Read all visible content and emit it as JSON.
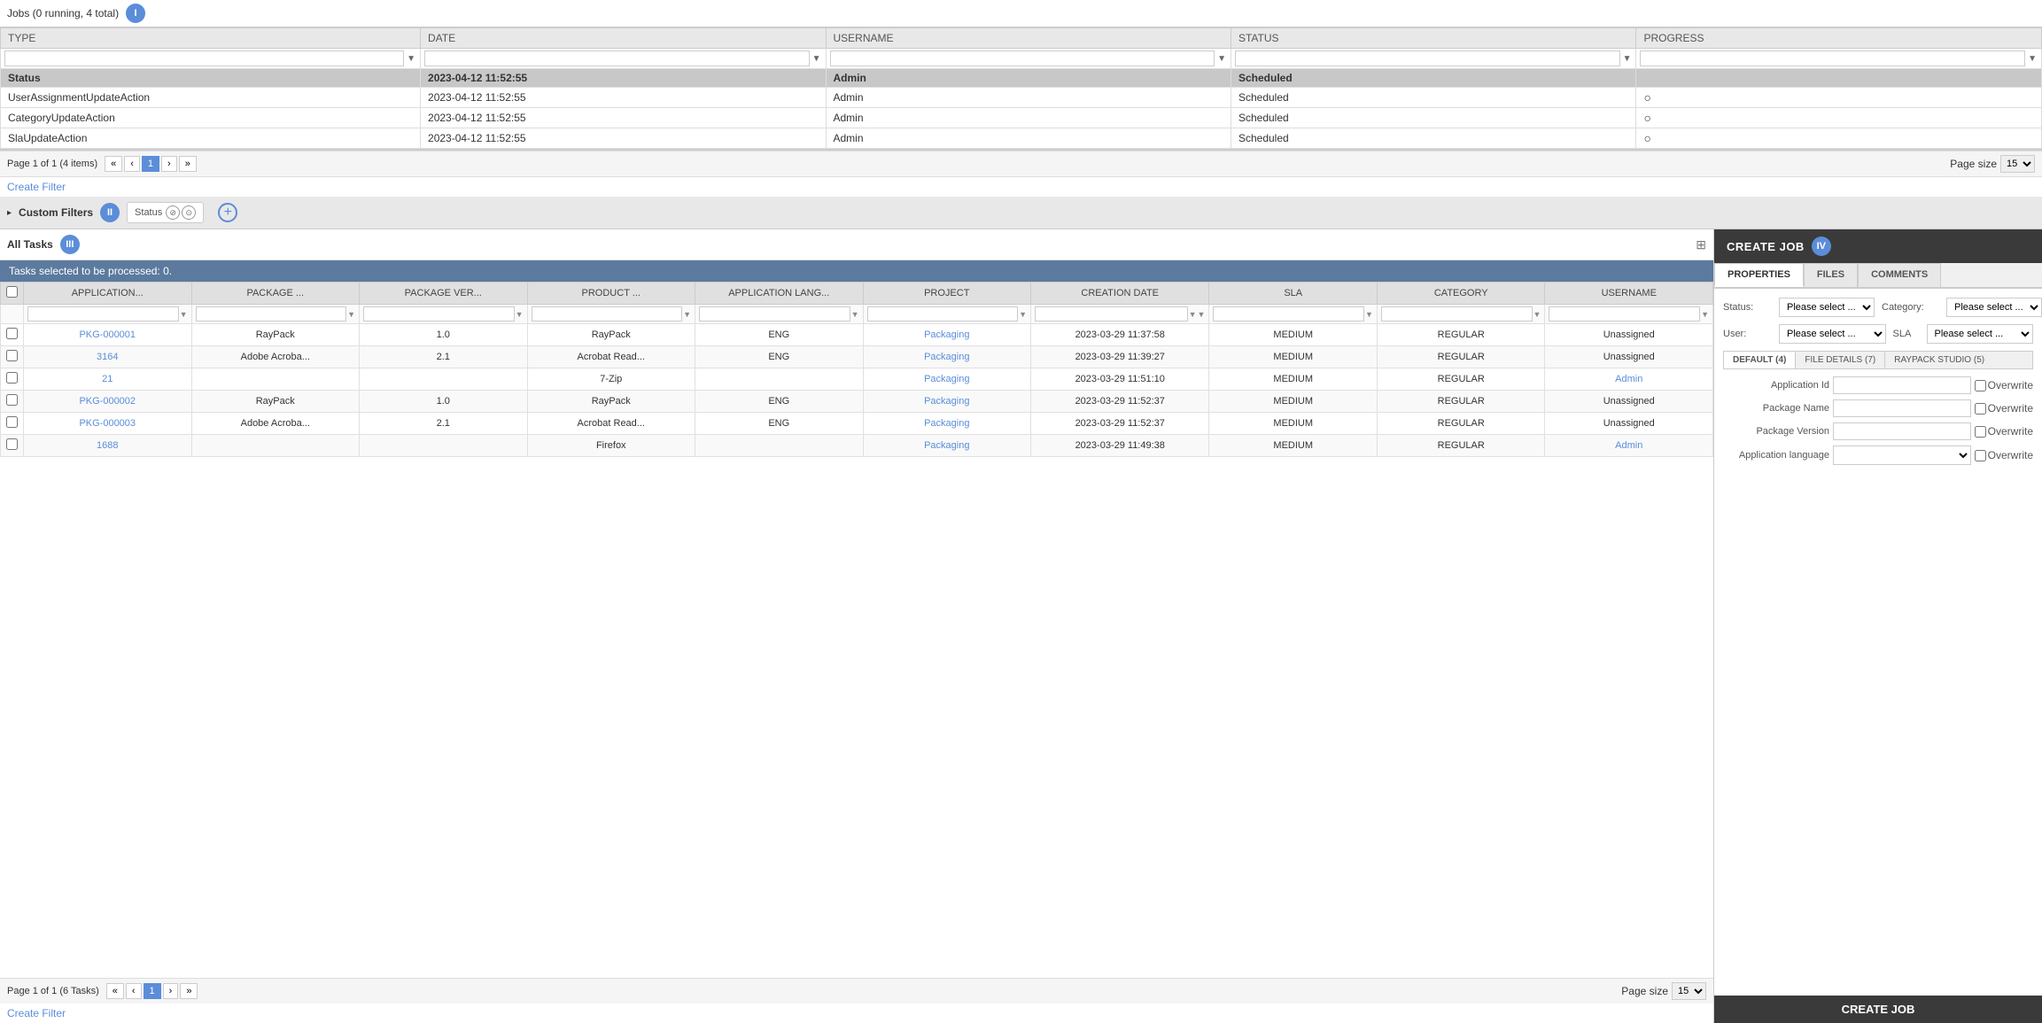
{
  "jobs_header": {
    "title": "Jobs (0 running, 4 total)",
    "badge": "I"
  },
  "jobs_table": {
    "columns": [
      "TYPE",
      "DATE",
      "USERNAME",
      "STATUS",
      "PROGRESS"
    ],
    "rows": [
      {
        "type": "Status",
        "date": "2023-04-12 11:52:55",
        "username": "Admin",
        "status": "Scheduled",
        "progress": "",
        "is_status": true
      },
      {
        "type": "UserAssignmentUpdateAction",
        "date": "2023-04-12 11:52:55",
        "username": "Admin",
        "status": "Scheduled",
        "progress": ""
      },
      {
        "type": "CategoryUpdateAction",
        "date": "2023-04-12 11:52:55",
        "username": "Admin",
        "status": "Scheduled",
        "progress": ""
      },
      {
        "type": "SlaUpdateAction",
        "date": "2023-04-12 11:52:55",
        "username": "Admin",
        "status": "Scheduled",
        "progress": ""
      }
    ]
  },
  "jobs_pagination": {
    "info": "Page 1 of 1 (4 items)",
    "page_size_label": "Page size",
    "page_size": "15"
  },
  "create_filter_label": "Create Filter",
  "custom_filters": {
    "title": "Custom Filters",
    "badge": "II",
    "filters": [
      {
        "label": "Status"
      }
    ]
  },
  "all_tasks": {
    "title": "All Tasks",
    "badge": "III",
    "selected_bar": "Tasks selected to be processed: 0.",
    "columns": [
      "APPLICATION...",
      "PACKAGE ...",
      "PACKAGE VER...",
      "PRODUCT ...",
      "APPLICATION LANG...",
      "PROJECT",
      "CREATION DATE",
      "SLA",
      "CATEGORY",
      "USERNAME"
    ],
    "rows": [
      {
        "id": 1,
        "app": "PKG-000001",
        "package": "RayPack",
        "pkg_ver": "1.0",
        "product": "RayPack",
        "app_lang": "ENG",
        "project": "Packaging",
        "creation_date": "2023-03-29 11:37:58",
        "sla": "MEDIUM",
        "category": "REGULAR",
        "username": "Unassigned"
      },
      {
        "id": 2,
        "app": "3164",
        "package": "Adobe Acroba...",
        "pkg_ver": "2.1",
        "product": "Acrobat Read...",
        "app_lang": "ENG",
        "project": "Packaging",
        "creation_date": "2023-03-29 11:39:27",
        "sla": "MEDIUM",
        "category": "REGULAR",
        "username": "Unassigned"
      },
      {
        "id": 3,
        "app": "21",
        "package": "",
        "pkg_ver": "",
        "product": "7-Zip",
        "app_lang": "",
        "project": "Packaging",
        "creation_date": "2023-03-29 11:51:10",
        "sla": "MEDIUM",
        "category": "REGULAR",
        "username": "Admin"
      },
      {
        "id": 4,
        "app": "PKG-000002",
        "package": "RayPack",
        "pkg_ver": "1.0",
        "product": "RayPack",
        "app_lang": "ENG",
        "project": "Packaging",
        "creation_date": "2023-03-29 11:52:37",
        "sla": "MEDIUM",
        "category": "REGULAR",
        "username": "Unassigned"
      },
      {
        "id": 5,
        "app": "PKG-000003",
        "package": "Adobe Acroba...",
        "pkg_ver": "2.1",
        "product": "Acrobat Read...",
        "app_lang": "ENG",
        "project": "Packaging",
        "creation_date": "2023-03-29 11:52:37",
        "sla": "MEDIUM",
        "category": "REGULAR",
        "username": "Unassigned"
      },
      {
        "id": 6,
        "app": "1688",
        "package": "",
        "pkg_ver": "",
        "product": "Firefox",
        "app_lang": "",
        "project": "Packaging",
        "creation_date": "2023-03-29 11:49:38",
        "sla": "MEDIUM",
        "category": "REGULAR",
        "username": "Admin"
      }
    ],
    "pagination": {
      "info": "Page 1 of 1 (6 Tasks)",
      "page_size": "15"
    }
  },
  "create_job_panel": {
    "title": "CREATE JOB",
    "badge": "IV",
    "tabs": [
      "PROPERTIES",
      "FILES",
      "COMMENTS"
    ],
    "active_tab": "PROPERTIES",
    "status_label": "Status:",
    "status_placeholder": "Please select ...",
    "category_label": "Category:",
    "category_placeholder": "Please select ...",
    "user_label": "User:",
    "user_placeholder": "Please select ...",
    "sla_label": "SLA",
    "sla_placeholder": "Please select ...",
    "sub_tabs": [
      "DEFAULT (4)",
      "FILE DETAILS (7)",
      "RAYPACK STUDIO (5)"
    ],
    "active_sub_tab": "DEFAULT (4)",
    "fields": [
      {
        "label": "Application Id",
        "value": "",
        "overwrite": true
      },
      {
        "label": "Package Name",
        "value": "",
        "overwrite": true
      },
      {
        "label": "Package Version",
        "value": "",
        "overwrite": true
      },
      {
        "label": "Application language",
        "value": "",
        "has_select": true,
        "overwrite": true
      }
    ],
    "create_button": "CREATE JOB",
    "comments_label": "COMMENTS",
    "category_detect": "CATEGORY",
    "please_select": "Please select _"
  }
}
